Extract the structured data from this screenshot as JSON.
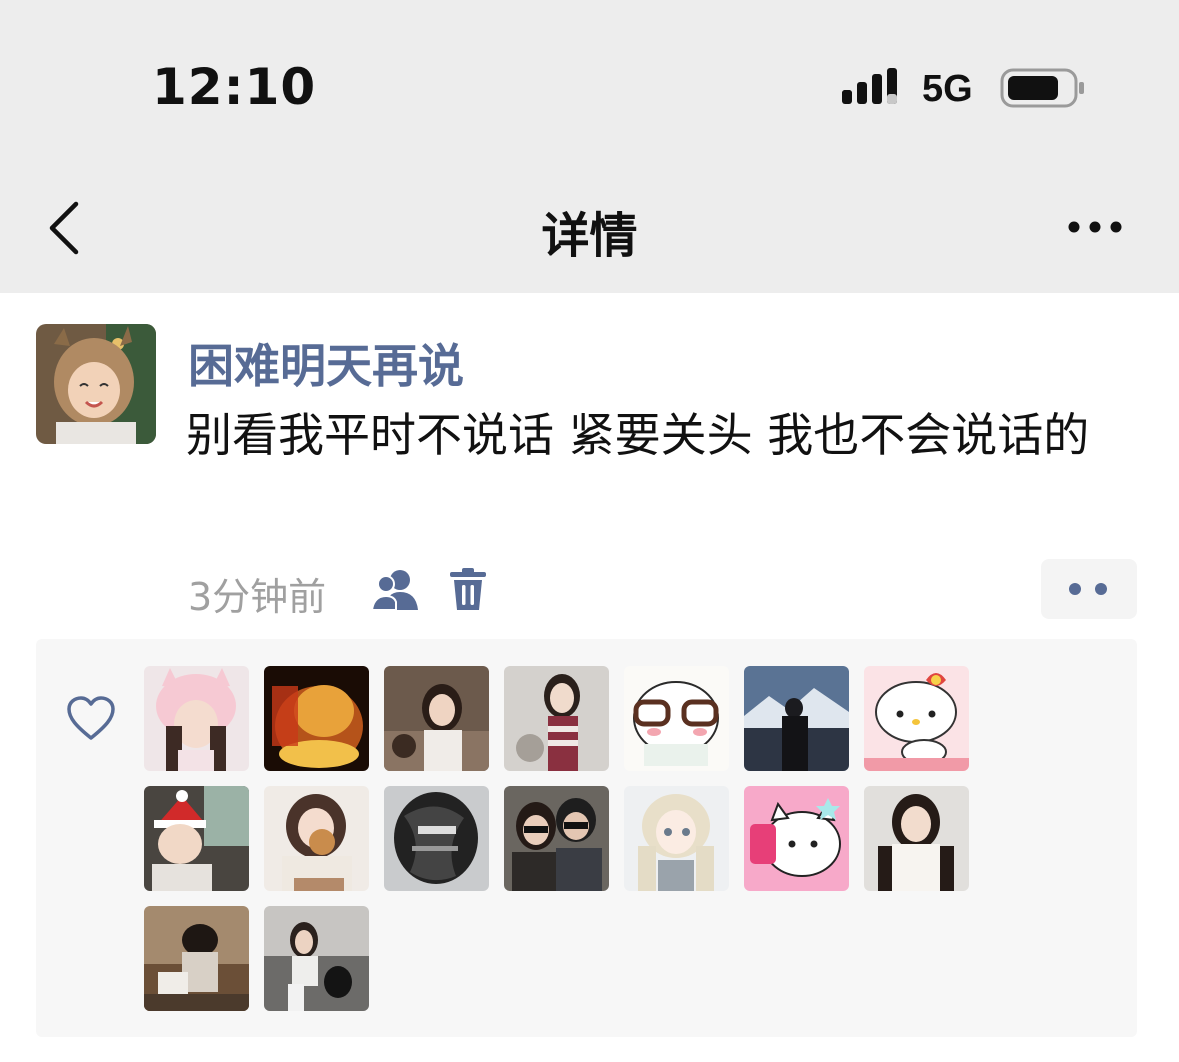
{
  "status_bar": {
    "time": "12:10",
    "network": "5G"
  },
  "nav": {
    "title": "详情"
  },
  "post": {
    "username": "困难明天再说",
    "text": "别看我平时不说话 紧要关头 我也不会说话的",
    "time_ago": "3分钟前"
  },
  "colors": {
    "link_blue": "#576b95",
    "top_bg": "#ededed",
    "likes_bg": "#f7f7f7"
  },
  "icons": [
    "back-chevron-icon",
    "more-dots-icon",
    "privacy-friends-icon",
    "trash-icon",
    "heart-icon",
    "signal-icon",
    "battery-icon"
  ],
  "likers": [
    {
      "avatar": "pink-bunny-hat-girl"
    },
    {
      "avatar": "golden-dragon-calligraphy"
    },
    {
      "avatar": "girl-at-dinner"
    },
    {
      "avatar": "girl-striped-shirt"
    },
    {
      "avatar": "cartoon-cat-glasses"
    },
    {
      "avatar": "man-on-mountain"
    },
    {
      "avatar": "hello-kitty-cake"
    },
    {
      "avatar": "baby-santa-hat"
    },
    {
      "avatar": "girl-with-cookie"
    },
    {
      "avatar": "dark-abstract-face"
    },
    {
      "avatar": "couple-sunglasses"
    },
    {
      "avatar": "anime-girl"
    },
    {
      "avatar": "pink-kitty-phone"
    },
    {
      "avatar": "girl-white-top"
    },
    {
      "avatar": "child-at-table"
    },
    {
      "avatar": "girl-on-sofa"
    }
  ]
}
